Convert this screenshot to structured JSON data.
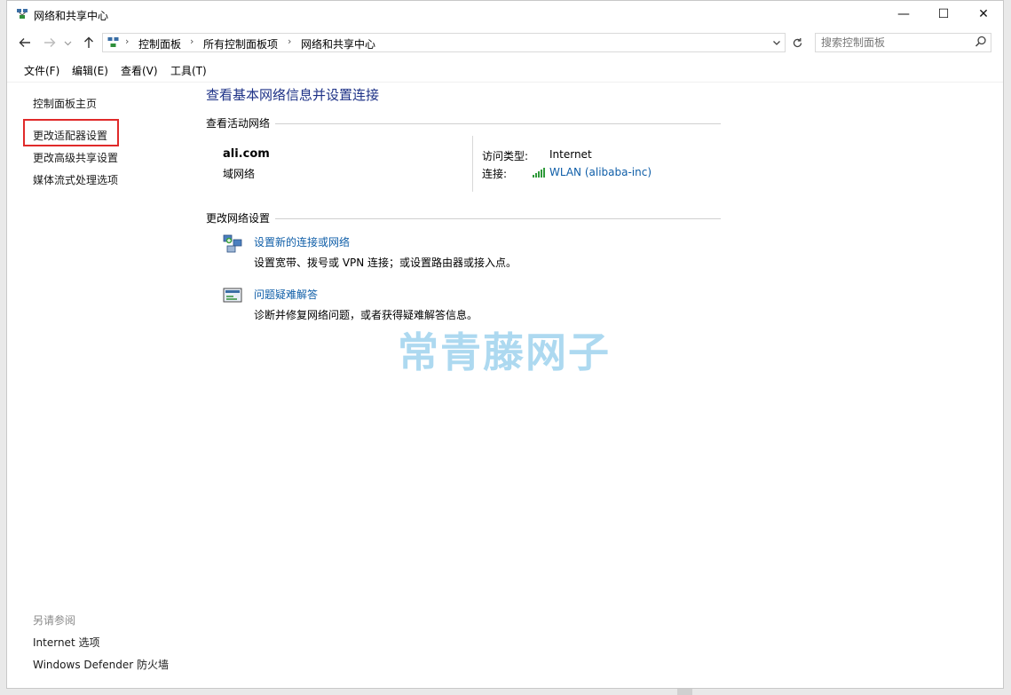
{
  "window": {
    "title": "网络和共享中心",
    "controls": {
      "minimize": "—",
      "maximize": "☐",
      "close": "✕"
    }
  },
  "nav": {
    "back_icon": "arrow-left-icon",
    "forward_icon": "arrow-right-icon",
    "recent_icon": "chevron-down-icon",
    "up_icon": "arrow-up-icon",
    "breadcrumbs": [
      "控制面板",
      "所有控制面板项",
      "网络和共享中心"
    ],
    "refresh_icon": "refresh-icon"
  },
  "search": {
    "placeholder": "搜索控制面板"
  },
  "menu": {
    "file": "文件(F)",
    "edit": "编辑(E)",
    "view": "查看(V)",
    "tools": "工具(T)"
  },
  "sidebar": {
    "items": [
      "控制面板主页",
      "更改适配器设置",
      "更改高级共享设置",
      "媒体流式处理选项"
    ],
    "see_also_heading": "另请参阅",
    "see_also": [
      "Internet 选项",
      "Windows Defender 防火墙"
    ],
    "highlight_color": "#e02a2a"
  },
  "main": {
    "title": "查看基本网络信息并设置连接",
    "active_heading": "查看活动网络",
    "network": {
      "name": "ali.com",
      "type": "域网络",
      "access_label": "访问类型:",
      "access_value": "Internet",
      "connection_label": "连接:",
      "connection_value": "WLAN (alibaba-inc)"
    },
    "change_heading": "更改网络设置",
    "tasks": [
      {
        "title": "设置新的连接或网络",
        "desc": "设置宽带、拨号或 VPN 连接；或设置路由器或接入点。",
        "icon": "network-setup-icon"
      },
      {
        "title": "问题疑难解答",
        "desc": "诊断并修复网络问题，或者获得疑难解答信息。",
        "icon": "troubleshoot-icon"
      }
    ],
    "link_color": "#0f5ea8",
    "title_color": "#1e3287"
  },
  "watermark": "常青藤网子"
}
